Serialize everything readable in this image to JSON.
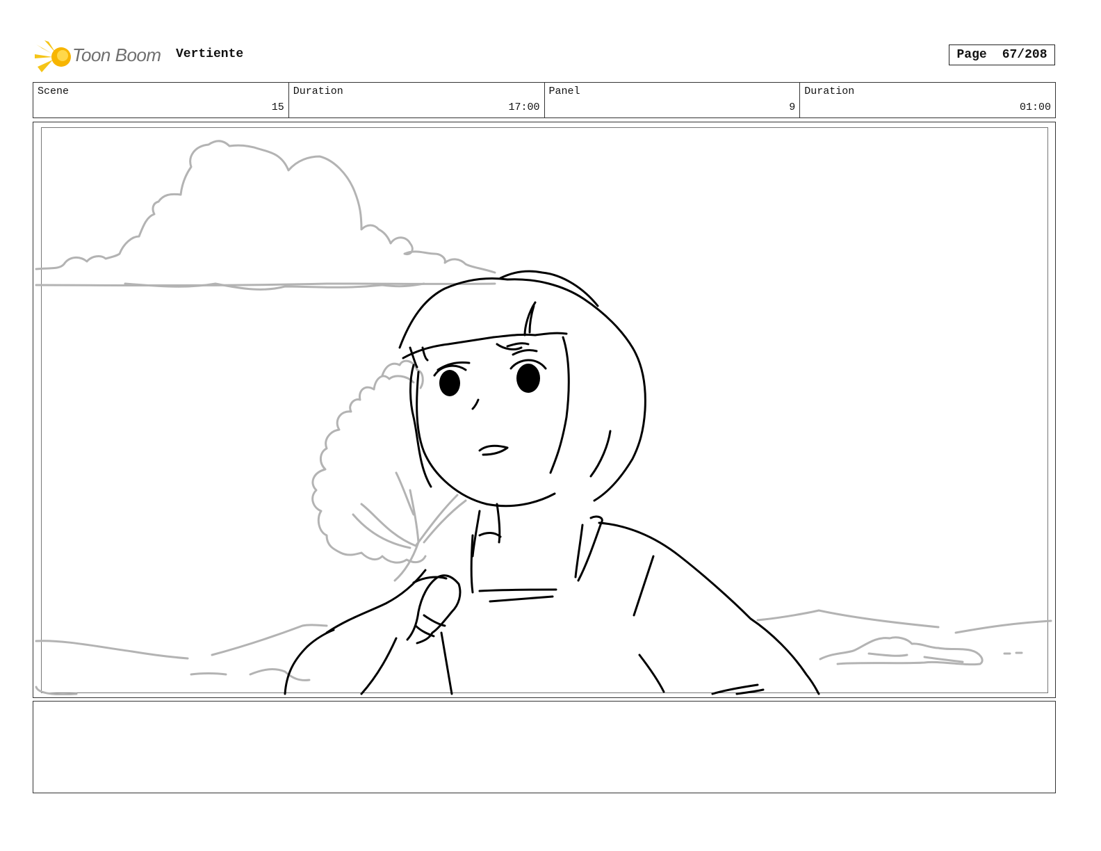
{
  "header": {
    "logo_text": "Toon Boom",
    "project_title": "Vertiente",
    "page_label": "Page",
    "page_number": "67/208"
  },
  "info": {
    "scene_label": "Scene",
    "scene_value": "15",
    "scene_duration_label": "Duration",
    "scene_duration_value": "17:00",
    "panel_label": "Panel",
    "panel_value": "9",
    "panel_duration_label": "Duration",
    "panel_duration_value": "01:00"
  },
  "colors": {
    "logo_burst": "#f5c518",
    "background_sketch": "#b3b3b3",
    "character_lines": "#000000"
  }
}
